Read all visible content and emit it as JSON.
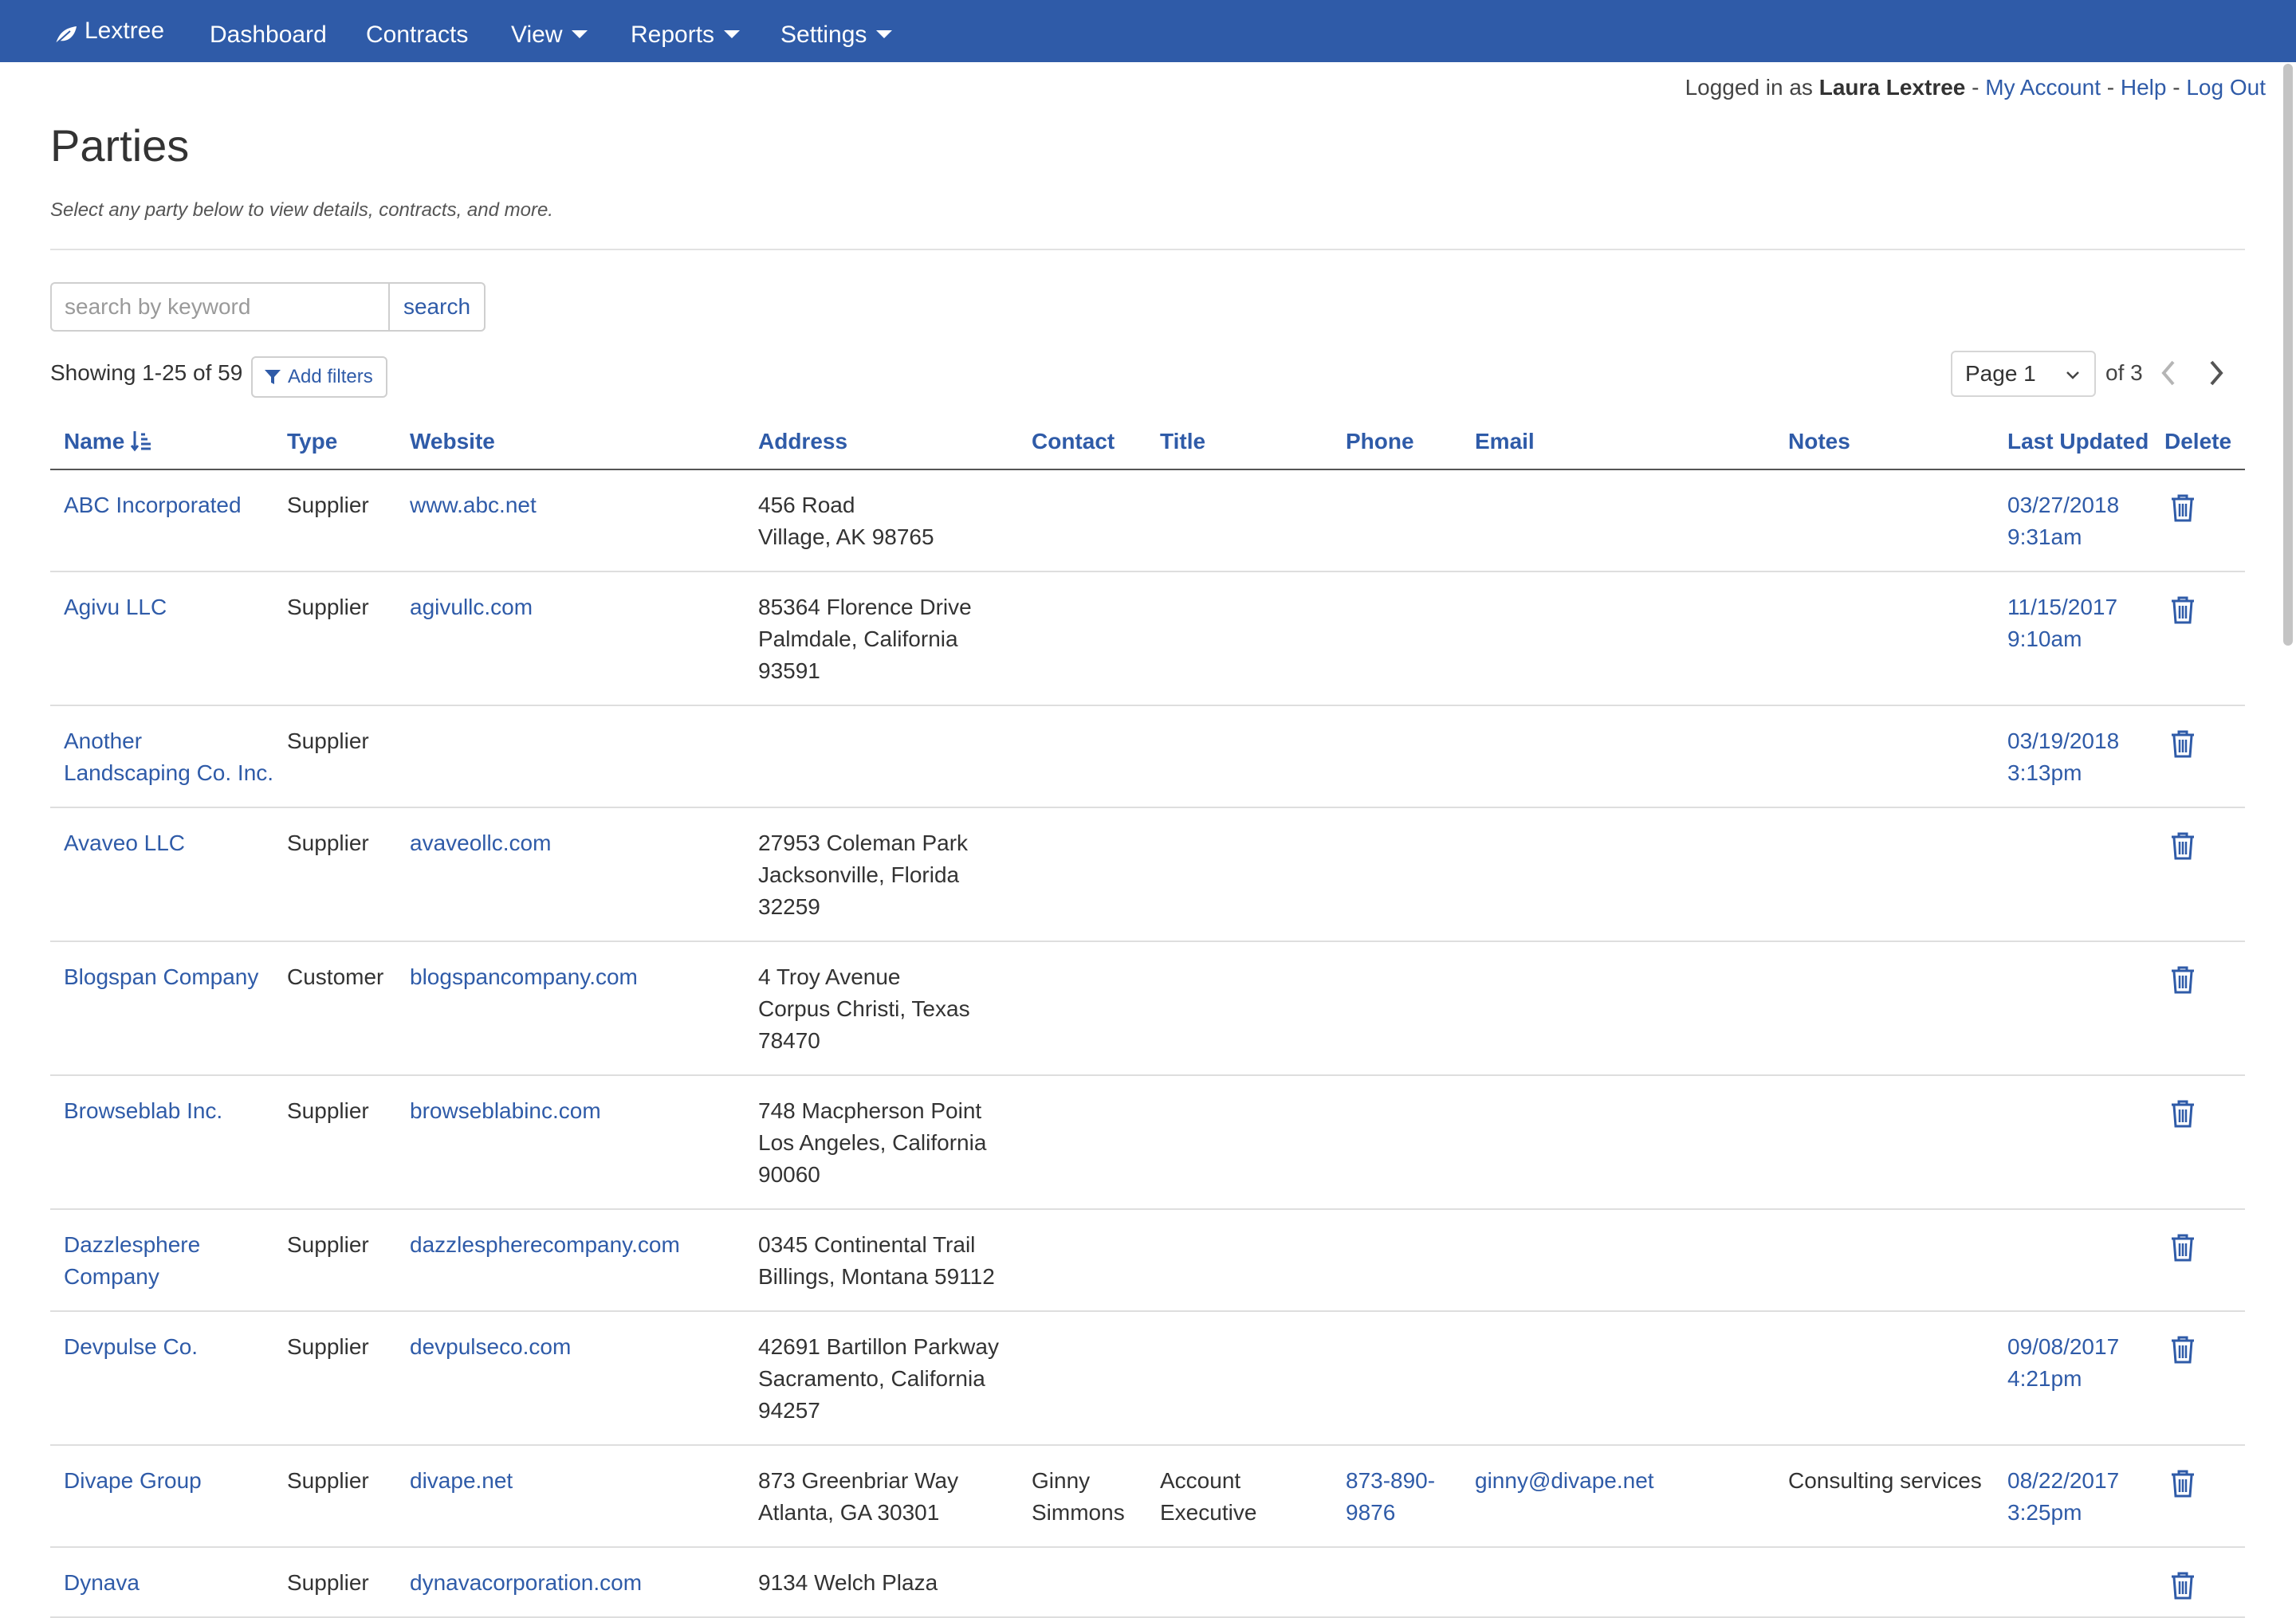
{
  "nav": {
    "brand": "Lextree",
    "items": [
      {
        "label": "Dashboard",
        "dropdown": false
      },
      {
        "label": "Contracts",
        "dropdown": false
      },
      {
        "label": "View",
        "dropdown": true
      },
      {
        "label": "Reports",
        "dropdown": true
      },
      {
        "label": "Settings",
        "dropdown": true
      }
    ]
  },
  "userbar": {
    "prefix": "Logged in as",
    "user": "Laura Lextree",
    "my_account": "My Account",
    "help": "Help",
    "logout": "Log Out",
    "sep": "-"
  },
  "page": {
    "title": "Parties",
    "subtitle": "Select any party below to view details, contracts, and more."
  },
  "search": {
    "placeholder": "search by keyword",
    "value": "",
    "button": "search"
  },
  "listing": {
    "showing": "Showing 1-25 of 59",
    "add_filters": "Add filters"
  },
  "pagination": {
    "current": "Page 1",
    "of": "of 3"
  },
  "table": {
    "columns": [
      "Name",
      "Type",
      "Website",
      "Address",
      "Contact",
      "Title",
      "Phone",
      "Email",
      "Notes",
      "Last Updated",
      "Delete"
    ],
    "rows": [
      {
        "name": [
          "ABC Incorporated"
        ],
        "type": "Supplier",
        "website": "www.abc.net",
        "address": [
          "456 Road",
          "Village, AK 98765"
        ],
        "contact": [],
        "title": [],
        "phone": [],
        "email": "",
        "notes": "",
        "updated": [
          "03/27/2018",
          "9:31am"
        ]
      },
      {
        "name": [
          "Agivu LLC"
        ],
        "type": "Supplier",
        "website": "agivullc.com",
        "address": [
          "85364 Florence Drive",
          "Palmdale, California",
          "93591"
        ],
        "contact": [],
        "title": [],
        "phone": [],
        "email": "",
        "notes": "",
        "updated": [
          "11/15/2017",
          "9:10am"
        ]
      },
      {
        "name": [
          "Another",
          "Landscaping Co. Inc."
        ],
        "type": "Supplier",
        "website": "",
        "address": [],
        "contact": [],
        "title": [],
        "phone": [],
        "email": "",
        "notes": "",
        "updated": [
          "03/19/2018",
          "3:13pm"
        ]
      },
      {
        "name": [
          "Avaveo LLC"
        ],
        "type": "Supplier",
        "website": "avaveollc.com",
        "address": [
          "27953 Coleman Park",
          "Jacksonville, Florida",
          "32259"
        ],
        "contact": [],
        "title": [],
        "phone": [],
        "email": "",
        "notes": "",
        "updated": []
      },
      {
        "name": [
          "Blogspan Company"
        ],
        "type": "Customer",
        "website": "blogspancompany.com",
        "address": [
          "4 Troy Avenue",
          "Corpus Christi, Texas",
          "78470"
        ],
        "contact": [],
        "title": [],
        "phone": [],
        "email": "",
        "notes": "",
        "updated": []
      },
      {
        "name": [
          "Browseblab Inc."
        ],
        "type": "Supplier",
        "website": "browseblabinc.com",
        "address": [
          "748 Macpherson Point",
          "Los Angeles, California",
          "90060"
        ],
        "contact": [],
        "title": [],
        "phone": [],
        "email": "",
        "notes": "",
        "updated": []
      },
      {
        "name": [
          "Dazzlesphere",
          "Company"
        ],
        "type": "Supplier",
        "website": "dazzlespherecompany.com",
        "address": [
          "0345 Continental Trail",
          "Billings, Montana 59112"
        ],
        "contact": [],
        "title": [],
        "phone": [],
        "email": "",
        "notes": "",
        "updated": []
      },
      {
        "name": [
          "Devpulse Co."
        ],
        "type": "Supplier",
        "website": "devpulseco.com",
        "address": [
          "42691 Bartillon Parkway",
          "Sacramento, California",
          "94257"
        ],
        "contact": [],
        "title": [],
        "phone": [],
        "email": "",
        "notes": "",
        "updated": [
          "09/08/2017",
          "4:21pm"
        ]
      },
      {
        "name": [
          "Divape Group"
        ],
        "type": "Supplier",
        "website": "divape.net",
        "address": [
          "873 Greenbriar Way",
          "Atlanta, GA 30301"
        ],
        "contact": [
          "Ginny",
          "Simmons"
        ],
        "title": [
          "Account",
          "Executive"
        ],
        "phone": [
          "873-890-",
          "9876"
        ],
        "email": "ginny@divape.net",
        "notes": "Consulting services",
        "updated": [
          "08/22/2017",
          "3:25pm"
        ]
      },
      {
        "name": [
          "Dynava"
        ],
        "type": "Supplier",
        "website": "dynavacorporation.com",
        "address": [
          "9134 Welch Plaza"
        ],
        "contact": [],
        "title": [],
        "phone": [],
        "email": "",
        "notes": "",
        "updated": []
      }
    ]
  },
  "colors": {
    "nav_bg": "#2f5ba8",
    "link": "#2f5ba8",
    "text": "#333333"
  }
}
